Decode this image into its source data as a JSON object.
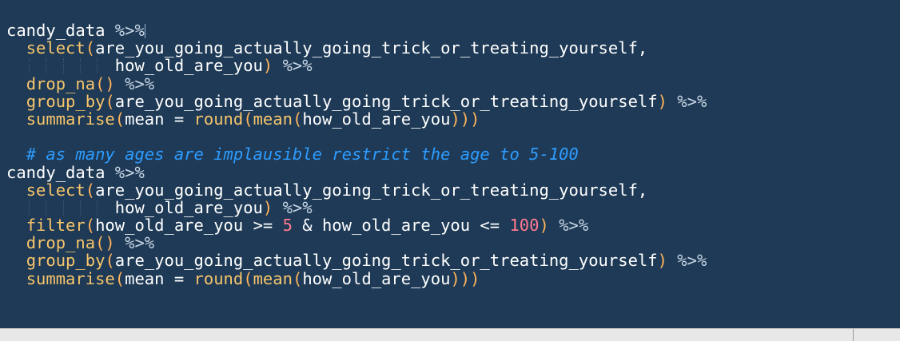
{
  "editor": {
    "lines": [
      [
        {
          "text": "candy_data ",
          "cls": "tok-plain"
        },
        {
          "text": "%>%",
          "cls": "tok-pipe"
        }
      ],
      [
        {
          "text": "  ",
          "cls": "tok-plain"
        },
        {
          "text": "select",
          "cls": "tok-fn"
        },
        {
          "text": "(",
          "cls": "tok-paren"
        },
        {
          "text": "are_you_going_actually_going_trick_or_treating_yourself,",
          "cls": "tok-plain"
        }
      ],
      [
        {
          "text": "           how_old_are_you",
          "cls": "tok-plain"
        },
        {
          "text": ")",
          "cls": "tok-paren"
        },
        {
          "text": " ",
          "cls": "tok-plain"
        },
        {
          "text": "%>%",
          "cls": "tok-pipe"
        }
      ],
      [
        {
          "text": "  ",
          "cls": "tok-plain"
        },
        {
          "text": "drop_na",
          "cls": "tok-fn"
        },
        {
          "text": "()",
          "cls": "tok-paren"
        },
        {
          "text": " ",
          "cls": "tok-plain"
        },
        {
          "text": "%>%",
          "cls": "tok-pipe"
        }
      ],
      [
        {
          "text": "  ",
          "cls": "tok-plain"
        },
        {
          "text": "group_by",
          "cls": "tok-fn"
        },
        {
          "text": "(",
          "cls": "tok-paren"
        },
        {
          "text": "are_you_going_actually_going_trick_or_treating_yourself",
          "cls": "tok-plain"
        },
        {
          "text": ")",
          "cls": "tok-paren"
        },
        {
          "text": " ",
          "cls": "tok-plain"
        },
        {
          "text": "%>%",
          "cls": "tok-pipe"
        }
      ],
      [
        {
          "text": "  ",
          "cls": "tok-plain"
        },
        {
          "text": "summarise",
          "cls": "tok-fn"
        },
        {
          "text": "(",
          "cls": "tok-paren"
        },
        {
          "text": "mean = ",
          "cls": "tok-plain"
        },
        {
          "text": "round",
          "cls": "tok-fn"
        },
        {
          "text": "(",
          "cls": "tok-paren"
        },
        {
          "text": "mean",
          "cls": "tok-fn"
        },
        {
          "text": "(",
          "cls": "tok-paren"
        },
        {
          "text": "how_old_are_you",
          "cls": "tok-plain"
        },
        {
          "text": ")))",
          "cls": "tok-paren"
        }
      ],
      [],
      [
        {
          "text": "  ",
          "cls": "tok-plain"
        },
        {
          "text": "# as many ages are implausible restrict the age to 5-100",
          "cls": "tok-comment"
        }
      ],
      [
        {
          "text": "candy_data ",
          "cls": "tok-plain"
        },
        {
          "text": "%>%",
          "cls": "tok-pipe"
        }
      ],
      [
        {
          "text": "  ",
          "cls": "tok-plain"
        },
        {
          "text": "select",
          "cls": "tok-fn"
        },
        {
          "text": "(",
          "cls": "tok-paren"
        },
        {
          "text": "are_you_going_actually_going_trick_or_treating_yourself,",
          "cls": "tok-plain"
        }
      ],
      [
        {
          "text": "           how_old_are_you",
          "cls": "tok-plain"
        },
        {
          "text": ")",
          "cls": "tok-paren"
        },
        {
          "text": " ",
          "cls": "tok-plain"
        },
        {
          "text": "%>%",
          "cls": "tok-pipe"
        }
      ],
      [
        {
          "text": "  ",
          "cls": "tok-plain"
        },
        {
          "text": "filter",
          "cls": "tok-fn"
        },
        {
          "text": "(",
          "cls": "tok-paren"
        },
        {
          "text": "how_old_are_you >= ",
          "cls": "tok-plain"
        },
        {
          "text": "5",
          "cls": "tok-num"
        },
        {
          "text": " & how_old_are_you <= ",
          "cls": "tok-plain"
        },
        {
          "text": "100",
          "cls": "tok-num"
        },
        {
          "text": ")",
          "cls": "tok-paren"
        },
        {
          "text": " ",
          "cls": "tok-plain"
        },
        {
          "text": "%>%",
          "cls": "tok-pipe"
        }
      ],
      [
        {
          "text": "  ",
          "cls": "tok-plain"
        },
        {
          "text": "drop_na",
          "cls": "tok-fn"
        },
        {
          "text": "()",
          "cls": "tok-paren"
        },
        {
          "text": " ",
          "cls": "tok-plain"
        },
        {
          "text": "%>%",
          "cls": "tok-pipe"
        }
      ],
      [
        {
          "text": "  ",
          "cls": "tok-plain"
        },
        {
          "text": "group_by",
          "cls": "tok-fn"
        },
        {
          "text": "(",
          "cls": "tok-paren"
        },
        {
          "text": "are_you_going_actually_going_trick_or_treating_yourself",
          "cls": "tok-plain"
        },
        {
          "text": ")",
          "cls": "tok-paren"
        },
        {
          "text": " ",
          "cls": "tok-plain"
        },
        {
          "text": "%>%",
          "cls": "tok-pipe"
        }
      ],
      [
        {
          "text": "  ",
          "cls": "tok-plain"
        },
        {
          "text": "summarise",
          "cls": "tok-fn"
        },
        {
          "text": "(",
          "cls": "tok-paren"
        },
        {
          "text": "mean = ",
          "cls": "tok-plain"
        },
        {
          "text": "round",
          "cls": "tok-fn"
        },
        {
          "text": "(",
          "cls": "tok-paren"
        },
        {
          "text": "mean",
          "cls": "tok-fn"
        },
        {
          "text": "(",
          "cls": "tok-paren"
        },
        {
          "text": "how_old_are_you",
          "cls": "tok-plain"
        },
        {
          "text": ")))",
          "cls": "tok-paren"
        }
      ]
    ]
  },
  "colors": {
    "background": "#1e3a56",
    "function": "#f7c56b",
    "pipe": "#c8d7e6",
    "paren": "#ffb35c",
    "number": "#ff7a8f",
    "comment": "#2d9cff",
    "text": "#ffffff"
  }
}
